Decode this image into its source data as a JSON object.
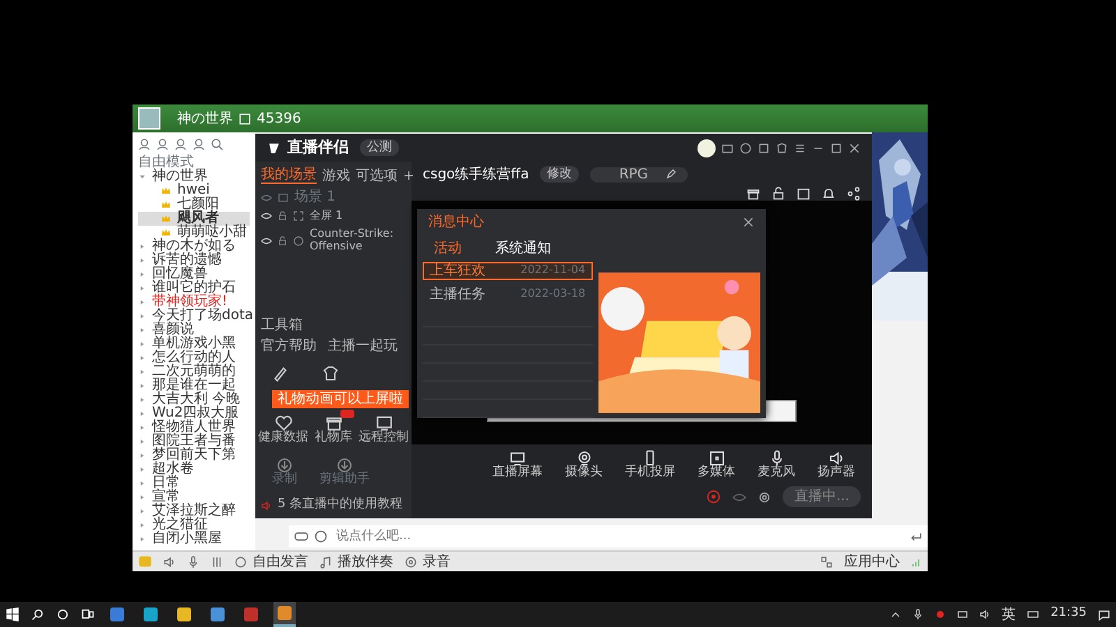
{
  "yy_window": {
    "channel_name": "神の世界",
    "user_count": "45396",
    "mode": "自由模式",
    "channels": [
      {
        "name": "神の世界",
        "alert": false,
        "expanded": true,
        "members": [
          {
            "name": "hwei",
            "selected": false
          },
          {
            "name": "七颜阳",
            "selected": false
          },
          {
            "name": "飓风者",
            "selected": true
          },
          {
            "name": "萌萌哒小甜",
            "selected": false
          }
        ]
      },
      {
        "name": "神の木が如る",
        "alert": false
      },
      {
        "name": "诉苦的遗憾",
        "alert": false
      },
      {
        "name": "回忆魔兽",
        "alert": false
      },
      {
        "name": "谁叫它的护石",
        "alert": false
      },
      {
        "name": "带神领玩家!",
        "alert": true
      },
      {
        "name": "今天打了场dota",
        "alert": false
      },
      {
        "name": "喜颜说",
        "alert": false
      },
      {
        "name": "单机游戏小黑",
        "alert": false
      },
      {
        "name": "怎么行动的人",
        "alert": false
      },
      {
        "name": "二次元萌萌的",
        "alert": false
      },
      {
        "name": "那是谁在一起",
        "alert": false
      },
      {
        "name": "大吉大利 今晚",
        "alert": false
      },
      {
        "name": "Wu2四叔大服",
        "alert": false
      },
      {
        "name": "怪物猎人世界",
        "alert": false
      },
      {
        "name": "图院王者与番",
        "alert": false
      },
      {
        "name": "梦回前天下第",
        "alert": false
      },
      {
        "name": "超水卷",
        "alert": false
      },
      {
        "name": "日常",
        "alert": false
      },
      {
        "name": "宣常",
        "alert": false
      },
      {
        "name": "艾泽拉斯之醉",
        "alert": false
      },
      {
        "name": "光之猎征",
        "alert": false
      },
      {
        "name": "自闭小黑屋",
        "alert": false
      }
    ],
    "chat_placeholder": "说点什么吧...",
    "bottom_bar": [
      "自由发言",
      "播放伴奏",
      "录音"
    ],
    "app_center": "应用中心"
  },
  "streamer_app": {
    "logo": "直播伴侣",
    "version_badge": "公测",
    "scene_tabs": [
      {
        "label": "我的场景",
        "selected": true
      },
      {
        "label": "游戏",
        "selected": false
      },
      {
        "label": "可选项",
        "selected": false
      }
    ],
    "scene": "场景 1",
    "sources": [
      "全屏 1",
      "Counter-Strike: Offensive"
    ],
    "stream_title": "csgo练手练营ffa",
    "edit_button": "修改",
    "category": "RPG",
    "toolbox_title": "工具箱",
    "toolbox_links": [
      "官方帮助",
      "主播一起玩"
    ],
    "tooltip": "礼物动画可以上屏啦",
    "tools": [
      {
        "label": "健康数据",
        "kind": "heart",
        "new": false
      },
      {
        "label": "礼物库",
        "kind": "gift",
        "new": true
      },
      {
        "label": "远程控制",
        "kind": "monitor",
        "new": false
      }
    ],
    "downloads": [
      "录制",
      "剪辑助手"
    ],
    "tutorial": "5 条直播中的使用教程",
    "controls": [
      {
        "label": "直播屏幕",
        "kind": "screen"
      },
      {
        "label": "摄像头",
        "kind": "camera"
      },
      {
        "label": "手机投屏",
        "kind": "phone"
      },
      {
        "label": "多媒体",
        "kind": "media"
      },
      {
        "label": "麦克风",
        "kind": "mic"
      },
      {
        "label": "扬声器",
        "kind": "speaker"
      }
    ],
    "live_button": "直播中...",
    "message_center": {
      "title": "消息中心",
      "tabs": [
        {
          "label": "活动",
          "selected": true
        },
        {
          "label": "系统通知",
          "selected": false
        }
      ],
      "messages": [
        {
          "title": "上车狂欢",
          "date": "2022-11-04",
          "selected": true
        },
        {
          "title": "主播任务",
          "date": "2022-03-18",
          "selected": false
        }
      ]
    }
  },
  "taskbar": {
    "apps": [
      {
        "color": "#3b7bd8",
        "selected": false
      },
      {
        "color": "#1aa3c9",
        "selected": false
      },
      {
        "color": "#e8b824",
        "selected": false
      },
      {
        "color": "#4a90d9",
        "selected": false
      },
      {
        "color": "#c0302a",
        "selected": false
      },
      {
        "color": "#e08a2c",
        "selected": true
      }
    ],
    "ime": "英",
    "time": "21:35"
  }
}
